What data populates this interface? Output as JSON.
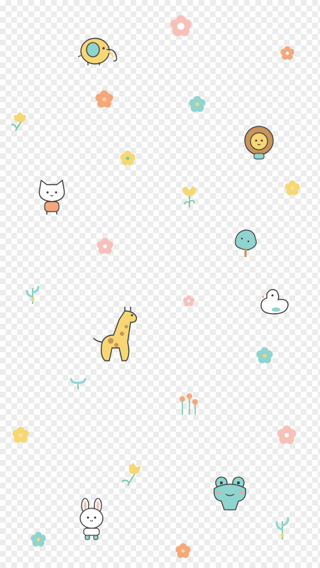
{
  "canvas": {
    "background": "transparent-checkerboard",
    "checker_light": "#ffffff",
    "checker_dark": "#ececec"
  },
  "palette": {
    "yellow": "#f7d774",
    "pink": "#f7c1ba",
    "orange": "#f4a87a",
    "mint": "#8fd4cf",
    "green_leaf": "#7cc8a4",
    "brown": "#c8945a",
    "outline": "#3a3a3a",
    "blush": "#f6a3a0"
  },
  "stickers": [
    {
      "name": "elephant-icon",
      "kind": "animal"
    },
    {
      "name": "lion-icon",
      "kind": "animal"
    },
    {
      "name": "cat-icon",
      "kind": "animal"
    },
    {
      "name": "giraffe-icon",
      "kind": "animal"
    },
    {
      "name": "duck-icon",
      "kind": "animal"
    },
    {
      "name": "frog-icon",
      "kind": "animal"
    },
    {
      "name": "bunny-icon",
      "kind": "animal"
    },
    {
      "name": "tree-icon",
      "kind": "plant"
    },
    {
      "name": "flower-icon",
      "kind": "plant"
    },
    {
      "name": "tulip-icon",
      "kind": "plant"
    },
    {
      "name": "sprout-icon",
      "kind": "plant"
    }
  ]
}
